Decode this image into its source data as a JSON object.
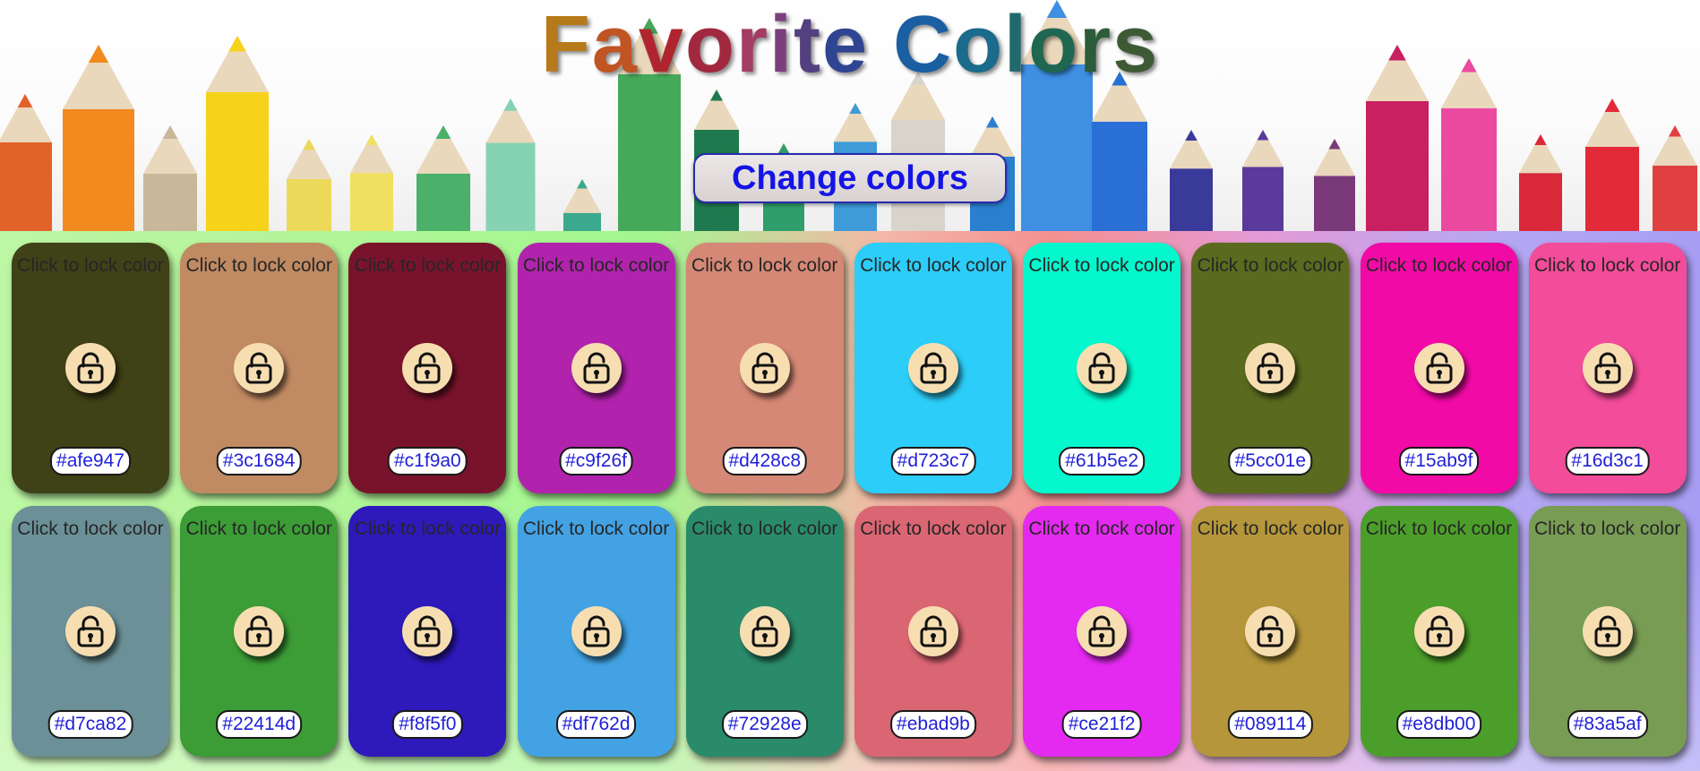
{
  "header": {
    "title_letters": [
      {
        "ch": "F",
        "color": "#b77a1a"
      },
      {
        "ch": "a",
        "color": "#c05422"
      },
      {
        "ch": "v",
        "color": "#b0252d"
      },
      {
        "ch": "o",
        "color": "#a2283f"
      },
      {
        "ch": "r",
        "color": "#a43d63"
      },
      {
        "ch": "i",
        "color": "#7c3f7d"
      },
      {
        "ch": "t",
        "color": "#53407f"
      },
      {
        "ch": "e",
        "color": "#2f4592"
      },
      {
        "ch": " ",
        "color": "#000000"
      },
      {
        "ch": "C",
        "color": "#1a5fa2"
      },
      {
        "ch": "o",
        "color": "#1a6b8c"
      },
      {
        "ch": "l",
        "color": "#206a6e"
      },
      {
        "ch": "o",
        "color": "#1f6750"
      },
      {
        "ch": "r",
        "color": "#2c5c3a"
      },
      {
        "ch": "s",
        "color": "#3e5a35"
      }
    ],
    "button_label": "Change colors"
  },
  "cards": [
    {
      "color": "#3f4117",
      "hint": "Click to lock color",
      "hex": "#afe947",
      "icon": "unlock-icon"
    },
    {
      "color": "#c08a62",
      "hint": "Click to lock color",
      "hex": "#3c1684",
      "icon": "unlock-icon"
    },
    {
      "color": "#79132b",
      "hint": "Click to lock color",
      "hex": "#c1f9a0",
      "icon": "unlock-icon"
    },
    {
      "color": "#b123ad",
      "hint": "Click to lock color",
      "hex": "#c9f26f",
      "icon": "unlock-icon"
    },
    {
      "color": "#d58875",
      "hint": "Click to lock color",
      "hex": "#d428c8",
      "icon": "unlock-icon"
    },
    {
      "color": "#2ccdf8",
      "hint": "Click to lock color",
      "hex": "#d723c7",
      "icon": "unlock-icon"
    },
    {
      "color": "#04f7cd",
      "hint": "Click to lock color",
      "hex": "#61b5e2",
      "icon": "unlock-icon"
    },
    {
      "color": "#5a6a1e",
      "hint": "Click to lock color",
      "hex": "#5cc01e",
      "icon": "unlock-icon"
    },
    {
      "color": "#f20aa6",
      "hint": "Click to lock color",
      "hex": "#15ab9f",
      "icon": "unlock-icon"
    },
    {
      "color": "#f34c9a",
      "hint": "Click to lock color",
      "hex": "#16d3c1",
      "icon": "unlock-icon"
    },
    {
      "color": "#6b9097",
      "hint": "Click to lock color",
      "hex": "#d7ca82",
      "icon": "unlock-icon"
    },
    {
      "color": "#3c9c36",
      "hint": "Click to lock color",
      "hex": "#22414d",
      "icon": "unlock-icon"
    },
    {
      "color": "#2e19bb",
      "hint": "Click to lock color",
      "hex": "#f8f5f0",
      "icon": "unlock-icon"
    },
    {
      "color": "#42a2e3",
      "hint": "Click to lock color",
      "hex": "#df762d",
      "icon": "unlock-icon"
    },
    {
      "color": "#2a8b6b",
      "hint": "Click to lock color",
      "hex": "#72928e",
      "icon": "unlock-icon"
    },
    {
      "color": "#db6673",
      "hint": "Click to lock color",
      "hex": "#ebad9b",
      "icon": "unlock-icon"
    },
    {
      "color": "#e42af0",
      "hint": "Click to lock color",
      "hex": "#ce21f2",
      "icon": "unlock-icon"
    },
    {
      "color": "#b5963a",
      "hint": "Click to lock color",
      "hex": "#089114",
      "icon": "unlock-icon"
    },
    {
      "color": "#4c9e2a",
      "hint": "Click to lock color",
      "hex": "#e8db00",
      "icon": "unlock-icon"
    },
    {
      "color": "#789c54",
      "hint": "Click to lock color",
      "hex": "#83a5af",
      "icon": "unlock-icon"
    }
  ]
}
